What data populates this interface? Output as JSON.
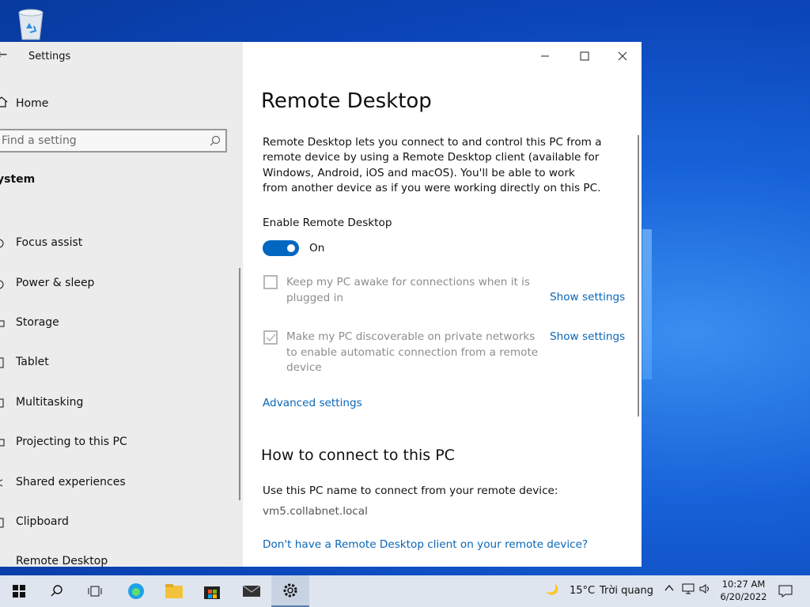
{
  "window": {
    "title": "Settings",
    "controls": {
      "minimize": "minimize",
      "maximize": "maximize",
      "close": "close"
    }
  },
  "sidebar": {
    "home_label": "Home",
    "search_placeholder": "Find a setting",
    "section_label": "ystem",
    "items": [
      {
        "label": "Focus assist",
        "icon": "moon-icon"
      },
      {
        "label": "Power & sleep",
        "icon": "power-icon"
      },
      {
        "label": "Storage",
        "icon": "storage-icon"
      },
      {
        "label": "Tablet",
        "icon": "tablet-icon"
      },
      {
        "label": "Multitasking",
        "icon": "multitasking-icon"
      },
      {
        "label": "Projecting to this PC",
        "icon": "projector-icon"
      },
      {
        "label": "Shared experiences",
        "icon": "share-icon"
      },
      {
        "label": "Clipboard",
        "icon": "clipboard-icon"
      },
      {
        "label": "Remote Desktop",
        "icon": "remote-desktop-icon"
      }
    ]
  },
  "content": {
    "title": "Remote Desktop",
    "description": "Remote Desktop lets you connect to and control this PC from a remote device by using a Remote Desktop client (available for Windows, Android, iOS and macOS). You'll be able to work from another device as if you were working directly on this PC.",
    "enable_label": "Enable Remote Desktop",
    "toggle_state": "On",
    "keep_awake_text": "Keep my PC awake for connections when it is plugged in",
    "keep_awake_link": "Show settings",
    "discoverable_text": "Make my PC discoverable on private networks to enable automatic connection from a remote device",
    "discoverable_link": "Show settings",
    "advanced_link": "Advanced settings",
    "how_title": "How to connect to this PC",
    "use_name_text": "Use this PC name to connect from your remote device:",
    "pc_name": "vm5.collabnet.local",
    "no_client_link": "Don't have a Remote Desktop client on your remote device?"
  },
  "taskbar": {
    "weather_temp": "15°C",
    "weather_desc": "Trời quang",
    "time": "10:27 AM",
    "date": "6/20/2022",
    "accent": "#0067c0"
  }
}
